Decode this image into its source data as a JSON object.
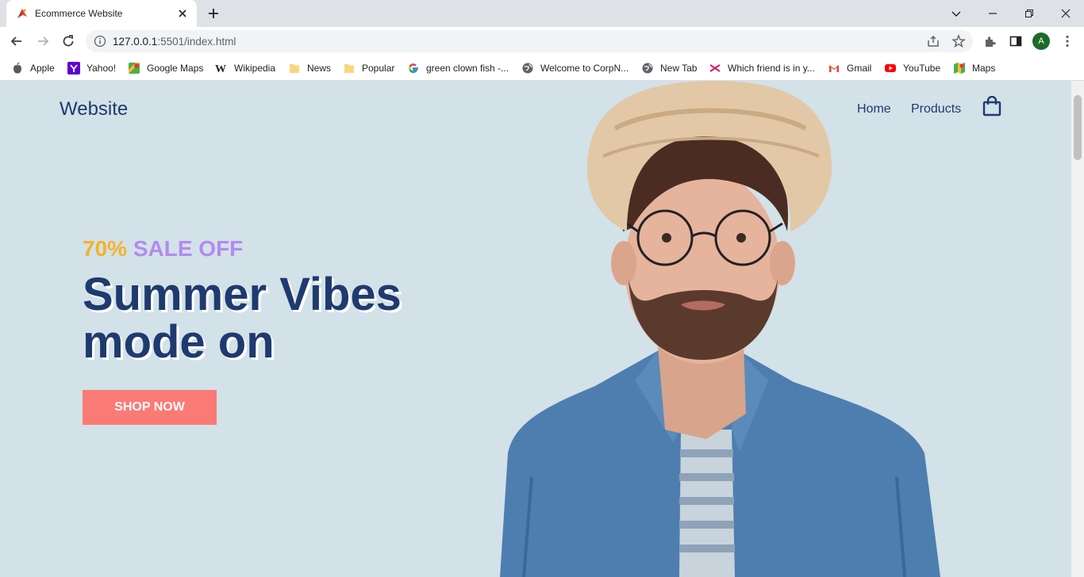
{
  "browser": {
    "tab_title": "Ecommerce Website",
    "url_host": "127.0.0.1",
    "url_path": ":5501/index.html",
    "profile_initial": "A"
  },
  "bookmarks": [
    {
      "label": "Apple",
      "icon": "apple-icon"
    },
    {
      "label": "Yahoo!",
      "icon": "yahoo-icon"
    },
    {
      "label": "Google Maps",
      "icon": "google-maps-icon"
    },
    {
      "label": "Wikipedia",
      "icon": "wikipedia-icon"
    },
    {
      "label": "News",
      "icon": "folder-icon"
    },
    {
      "label": "Popular",
      "icon": "folder-icon"
    },
    {
      "label": "green clown fish -...",
      "icon": "google-icon"
    },
    {
      "label": "Welcome to CorpN...",
      "icon": "globe-icon"
    },
    {
      "label": "New Tab",
      "icon": "globe-icon"
    },
    {
      "label": "Which friend is in y...",
      "icon": "quiz-icon"
    },
    {
      "label": "Gmail",
      "icon": "gmail-icon"
    },
    {
      "label": "YouTube",
      "icon": "youtube-icon"
    },
    {
      "label": "Maps",
      "icon": "maps-icon"
    }
  ],
  "site": {
    "brand": "Website",
    "nav": {
      "home": "Home",
      "products": "Products"
    },
    "hero": {
      "sale_pct": "70%",
      "sale_text": "SALE OFF",
      "headline_line1": "Summer Vibes",
      "headline_line2": "mode on",
      "cta": "SHOP NOW"
    }
  },
  "colors": {
    "page_bg": "#d3e1e8",
    "navy": "#1f3a6e",
    "sale_orange": "#f5b229",
    "sale_purple": "#b48af0",
    "cta_bg": "#fa7a75"
  }
}
